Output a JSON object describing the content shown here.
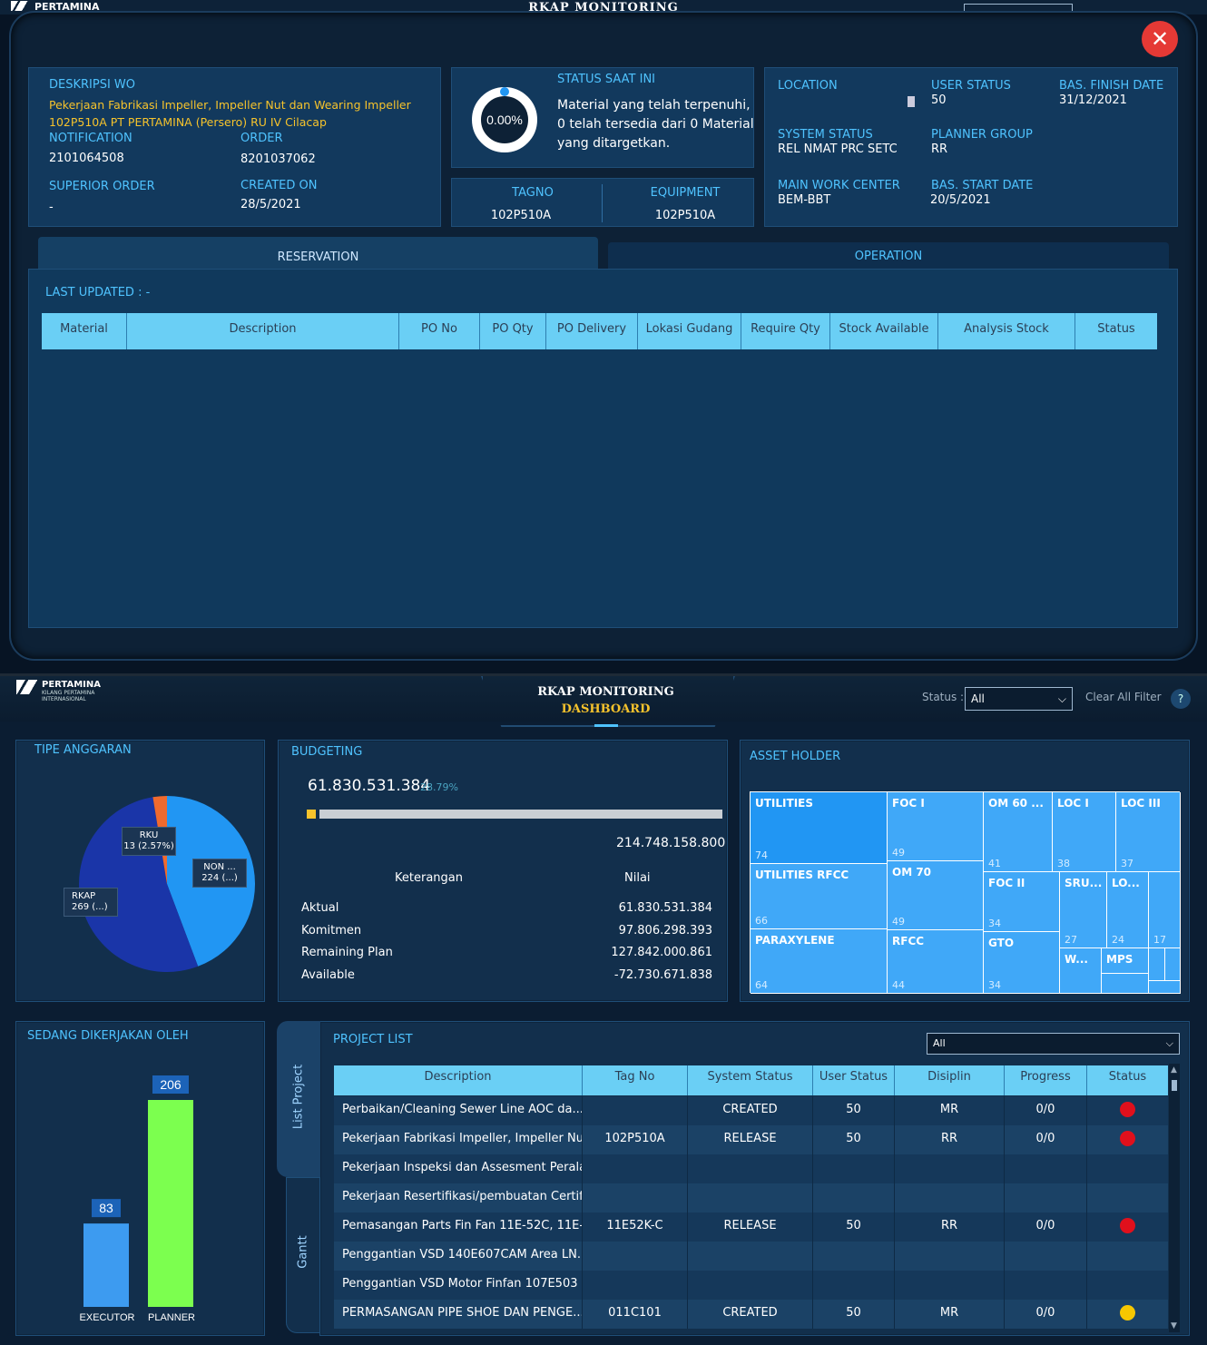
{
  "modal": {
    "behind_logo": "PERTAMINA",
    "behind_title": "RKAP MONITORING",
    "wo": {
      "desc_label": "DESKRIPSI WO",
      "desc_line1": "Pekerjaan Fabrikasi Impeller, Impeller Nut dan Wearing Impeller",
      "desc_line2": "102P510A PT PERTAMINA (Persero) RU IV Cilacap",
      "notification_label": "NOTIFICATION",
      "notification": "2101064508",
      "order_label": "ORDER",
      "order": "8201037062",
      "superior_label": "SUPERIOR ORDER",
      "superior": "-",
      "created_label": "CREATED ON",
      "created": "28/5/2021"
    },
    "status": {
      "label": "STATUS SAAT INI",
      "percent": "0.00%",
      "progress": 0,
      "line1": "Material yang telah terpenuhi,",
      "line2": "0 telah tersedia dari 0 Material",
      "line3": "yang ditargetkan."
    },
    "tag": {
      "tagno_label": "TAGNO",
      "tagno": "102P510A",
      "equipment_label": "EQUIPMENT",
      "equipment": "102P510A"
    },
    "info": {
      "location_label": "LOCATION",
      "user_status_label": "USER STATUS",
      "user_status": "50",
      "finish_label": "BAS. FINISH DATE",
      "finish": "31/12/2021",
      "system_status_label": "SYSTEM STATUS",
      "system_status": "REL NMAT PRC SETC",
      "planner_label": "PLANNER GROUP",
      "planner": "RR",
      "work_center_label": "MAIN WORK CENTER",
      "work_center": "BEM-BBT",
      "start_label": "BAS. START DATE",
      "start": "20/5/2021"
    },
    "tabs": {
      "reservation": "RESERVATION",
      "operation": "OPERATION"
    },
    "last_updated": "LAST UPDATED : -",
    "columns": [
      "Material",
      "Description",
      "PO No",
      "PO Qty",
      "PO Delivery",
      "Lokasi Gudang",
      "Require Qty",
      "Stock Available",
      "Analysis Stock",
      "Status"
    ]
  },
  "dash": {
    "logo": "PERTAMINA",
    "logo_sub1": "KILANG PERTAMINA",
    "logo_sub2": "INTERNASIONAL",
    "title": "RKAP MONITORING",
    "subtitle": "DASHBOARD",
    "status_label": "Status :",
    "status_value": "All",
    "clear_filter": "Clear All Filter",
    "help": "?",
    "tipe": {
      "title": "TIPE ANGGARAN",
      "rku_label": "RKU",
      "rku_value": "13 (2.57%)",
      "non_label": "NON ...",
      "non_value": "224 (...)",
      "rkap_label": "RKAP",
      "rkap_value": "269 (...)"
    },
    "budgeting": {
      "title": "BUDGETING",
      "amount": "61.830.531.384",
      "percent": "28.79%",
      "total": "214.748.158.800",
      "col_ket": "Keterangan",
      "col_nilai": "Nilai",
      "rows": [
        {
          "k": "Aktual",
          "v": "61.830.531.384"
        },
        {
          "k": "Komitmen",
          "v": "97.806.298.393"
        },
        {
          "k": "Remaining Plan",
          "v": "127.842.000.861"
        },
        {
          "k": "Available",
          "v": "-72.730.671.838"
        }
      ]
    },
    "asset": {
      "title": "ASSET HOLDER",
      "cells": [
        {
          "name": "UTILITIES",
          "count": "74"
        },
        {
          "name": "FOC I",
          "count": "49"
        },
        {
          "name": "OM 60 ...",
          "count": "41"
        },
        {
          "name": "LOC I",
          "count": "38"
        },
        {
          "name": "LOC III",
          "count": "37"
        },
        {
          "name": "UTILITIES RFCC",
          "count": "66"
        },
        {
          "name": "OM 70",
          "count": "49"
        },
        {
          "name": "FOC II",
          "count": "34"
        },
        {
          "name": "SRU...",
          "count": "27"
        },
        {
          "name": "LO...",
          "count": "24"
        },
        {
          "name": "",
          "count": "17"
        },
        {
          "name": "PARAXYLENE",
          "count": "64"
        },
        {
          "name": "RFCC",
          "count": "44"
        },
        {
          "name": "GTO",
          "count": "34"
        },
        {
          "name": "W...",
          "count": ""
        },
        {
          "name": "MPS",
          "count": ""
        }
      ]
    },
    "sedang": {
      "title": "SEDANG DIKERJAKAN OLEH",
      "bars": [
        {
          "label": "EXECUTOR",
          "value": 83,
          "display": "83",
          "color": "#3d9bf0"
        },
        {
          "label": "PLANNER",
          "value": 206,
          "display": "206",
          "color": "#7cff4f"
        }
      ]
    },
    "project": {
      "title": "PROJECT LIST",
      "filter": "All",
      "tab_list": "List Project",
      "tab_gantt": "Gantt",
      "columns": [
        "Description",
        "Tag No",
        "System Status",
        "User Status",
        "Disiplin",
        "Progress",
        "Status"
      ],
      "rows": [
        {
          "desc": "Perbaikan/Cleaning Sewer Line AOC da...",
          "tag": "",
          "sys": "CREATED",
          "user": "50",
          "dis": "MR",
          "prog": "0/0",
          "status": "red"
        },
        {
          "desc": "Pekerjaan Fabrikasi Impeller, Impeller Nu...",
          "tag": "102P510A",
          "sys": "RELEASE",
          "user": "50",
          "dis": "RR",
          "prog": "0/0",
          "status": "red"
        },
        {
          "desc": "Pekerjaan Inspeksi dan Assesment Perala...",
          "tag": "",
          "sys": "",
          "user": "",
          "dis": "",
          "prog": "",
          "status": ""
        },
        {
          "desc": "Pekerjaan Resertifikasi/pembuatan Certif...",
          "tag": "",
          "sys": "",
          "user": "",
          "dis": "",
          "prog": "",
          "status": ""
        },
        {
          "desc": "Pemasangan Parts Fin Fan 11E-52C, 11E-...",
          "tag": "11E52K-C",
          "sys": "RELEASE",
          "user": "50",
          "dis": "RR",
          "prog": "0/0",
          "status": "red"
        },
        {
          "desc": "Penggantian VSD 140E607CAM Area LN...",
          "tag": "",
          "sys": "",
          "user": "",
          "dis": "",
          "prog": "",
          "status": ""
        },
        {
          "desc": "Penggantian VSD Motor Finfan 107E503 ...",
          "tag": "",
          "sys": "",
          "user": "",
          "dis": "",
          "prog": "",
          "status": ""
        },
        {
          "desc": "PERMASANGAN PIPE SHOE DAN PENGE...",
          "tag": "011C101",
          "sys": "CREATED",
          "user": "50",
          "dis": "MR",
          "prog": "0/0",
          "status": "yellow"
        }
      ]
    }
  },
  "colors": {
    "accent": "#4fc3ff",
    "header_cell": "#6acff5",
    "red": "#e0101c",
    "yellow": "#f6c700"
  }
}
